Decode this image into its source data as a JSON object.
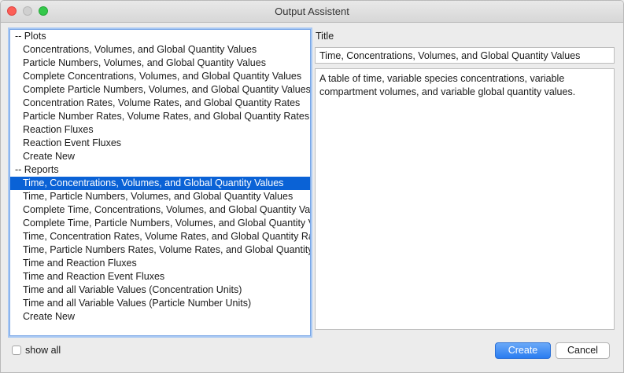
{
  "window": {
    "title": "Output Assistent"
  },
  "list": {
    "items": [
      {
        "label": "-- Plots",
        "kind": "header"
      },
      {
        "label": "Concentrations, Volumes, and Global Quantity Values",
        "kind": "item"
      },
      {
        "label": "Particle Numbers, Volumes, and Global Quantity Values",
        "kind": "item"
      },
      {
        "label": "Complete Concentrations, Volumes, and Global Quantity Values",
        "kind": "item"
      },
      {
        "label": "Complete Particle Numbers, Volumes, and Global Quantity Values",
        "kind": "item"
      },
      {
        "label": "Concentration Rates, Volume Rates, and Global Quantity Rates",
        "kind": "item"
      },
      {
        "label": "Particle Number Rates, Volume Rates, and Global Quantity Rates",
        "kind": "item"
      },
      {
        "label": "Reaction Fluxes",
        "kind": "item"
      },
      {
        "label": "Reaction Event Fluxes",
        "kind": "item"
      },
      {
        "label": "Create New",
        "kind": "item"
      },
      {
        "label": "-- Reports",
        "kind": "header"
      },
      {
        "label": "Time, Concentrations, Volumes, and Global Quantity Values",
        "kind": "item",
        "selected": true
      },
      {
        "label": "Time, Particle Numbers, Volumes, and Global Quantity Values",
        "kind": "item"
      },
      {
        "label": "Complete Time, Concentrations, Volumes, and Global Quantity Values",
        "kind": "item"
      },
      {
        "label": "Complete Time, Particle Numbers, Volumes, and Global Quantity Values",
        "kind": "item"
      },
      {
        "label": "Time, Concentration Rates, Volume Rates, and Global Quantity Rates",
        "kind": "item"
      },
      {
        "label": "Time, Particle Numbers Rates, Volume Rates, and Global Quantity Rates",
        "kind": "item"
      },
      {
        "label": "Time and Reaction Fluxes",
        "kind": "item"
      },
      {
        "label": "Time and Reaction Event Fluxes",
        "kind": "item"
      },
      {
        "label": "Time and all Variable Values (Concentration Units)",
        "kind": "item"
      },
      {
        "label": "Time and all Variable Values (Particle Number Units)",
        "kind": "item"
      },
      {
        "label": "Create New",
        "kind": "item"
      }
    ]
  },
  "details": {
    "title_label": "Title",
    "title_value": "Time, Concentrations, Volumes, and Global Quantity Values",
    "description": "A table of time, variable species concentrations, variable compartment volumes, and variable global quantity values."
  },
  "footer": {
    "show_all_label": "show all",
    "show_all_checked": false,
    "create_label": "Create",
    "cancel_label": "Cancel"
  },
  "colors": {
    "selection": "#0a62d6",
    "primary_button": "#2a7cf0",
    "focus_ring": "#a8c8f3"
  }
}
